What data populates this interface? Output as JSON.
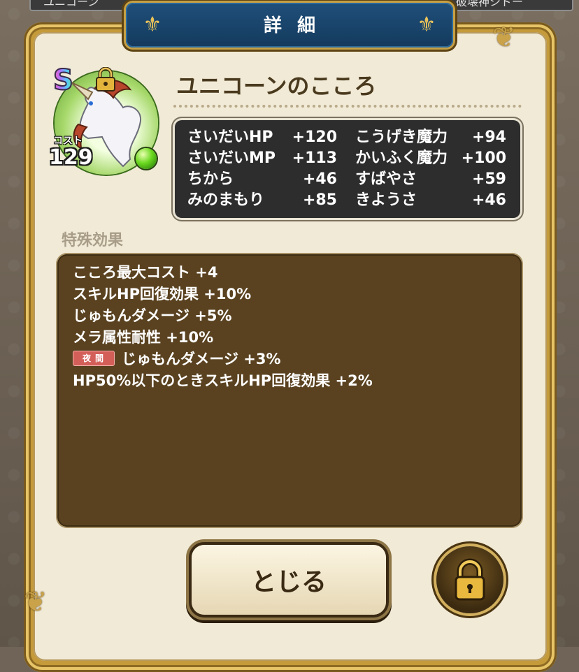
{
  "top_tabs": {
    "left": "ユニコーン",
    "right": "破壊神シドー"
  },
  "header": {
    "title": "詳細"
  },
  "monster": {
    "rank": "S",
    "name": "ユニコーンのこころ",
    "cost_label": "コスト",
    "cost_value": "129",
    "orb_color": "#6ad81f"
  },
  "stats": [
    {
      "label": "さいだいHP",
      "value": "+120"
    },
    {
      "label": "こうげき魔力",
      "value": "+94"
    },
    {
      "label": "さいだいMP",
      "value": "+113"
    },
    {
      "label": "かいふく魔力",
      "value": "+100"
    },
    {
      "label": "ちから",
      "value": "+46"
    },
    {
      "label": "すばやさ",
      "value": "+59"
    },
    {
      "label": "みのまもり",
      "value": "+85"
    },
    {
      "label": "きようさ",
      "value": "+46"
    }
  ],
  "special": {
    "label": "特殊効果",
    "effects": [
      {
        "text": "こころ最大コスト +4"
      },
      {
        "text": "スキルHP回復効果 +10%"
      },
      {
        "text": "じゅもんダメージ +5%"
      },
      {
        "text": "メラ属性耐性 +10%"
      },
      {
        "badge": "夜間",
        "text": "じゅもんダメージ +3%"
      },
      {
        "text": "HP50%以下のときスキルHP回復効果 +2%"
      }
    ]
  },
  "buttons": {
    "close": "とじる",
    "lock_icon": "padlock-icon"
  },
  "colors": {
    "header": "#1f4f7a",
    "panel": "#f1ead7",
    "effects_bg": "#5a4220",
    "stats_bg": "#2d2d2d",
    "night_badge": "#d45f59"
  }
}
